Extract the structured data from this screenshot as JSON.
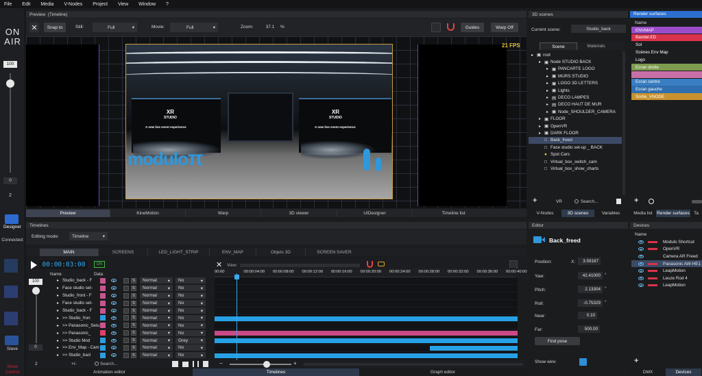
{
  "menu": [
    "File",
    "Edit",
    "Media",
    "V-Nodes",
    "Project",
    "View",
    "Window",
    "?"
  ],
  "left": {
    "on_air_line1": "ON",
    "on_air_line2": "AIR",
    "value_top": "100",
    "value_mid": "0",
    "value_bottom": "2",
    "designer_label": "Designer",
    "connected_label": "Connected:",
    "slave_label": "Slave",
    "show_control_line1": "Show",
    "show_control_line2": "Control"
  },
  "preview": {
    "title_prefix": "Preview",
    "title_suffix": "(Timeline)",
    "snap_label": "Snap to",
    "still_label": "Still:",
    "still_value": "Full",
    "movie_label": "Movie:",
    "movie_value": "Full",
    "zoom_label": "Zoom:",
    "zoom_value": "37.1",
    "zoom_unit": "%",
    "guides_label": "Guides",
    "warp_label": "Warp Off",
    "fps": "21 FPS",
    "logo_line1": "XR",
    "logo_line2": "STUDIO",
    "tagline": "A new live event experience",
    "brand_text": "modulo",
    "brand_symbol": "π",
    "tabs": [
      "Preview",
      "KineMotion",
      "Warp",
      "3D viewer",
      "UIDesigner",
      "Timeline list"
    ]
  },
  "timelines": {
    "title": "Timelines",
    "editing_mode_label": "Editing mode:",
    "editing_mode_value": "Timeline",
    "tabs": [
      "MAIN",
      "SCREENS",
      "LED_LIGHT_STRIP",
      "ENV_MAP",
      "Objets 3D",
      "SCREEN SAVER"
    ],
    "timecode": "00:00:03:00",
    "on_badge": "ON",
    "view_label": "View:",
    "col_name": "Name",
    "col_data": "Data",
    "ruler": [
      "00:00",
      "00:00:04:00",
      "00:00:08:00",
      "00:00:12:00",
      "00:00:16:00",
      "00:00:20:00",
      "00:00:24:00",
      "00:00:28:00",
      "00:00:32:00",
      "00:00:36:00",
      "00:00:40:00"
    ],
    "rows": [
      {
        "name": "Studio_back - F",
        "color": "#c8558f",
        "mode": "Normal",
        "opt": "No",
        "bar": null
      },
      {
        "name": "Face studio set-",
        "color": "#c8558f",
        "mode": "Normal",
        "opt": "No",
        "bar": null
      },
      {
        "name": "Studio_front - F",
        "color": "#c8558f",
        "mode": "Normal",
        "opt": "No",
        "bar": null
      },
      {
        "name": "Face studio set-",
        "color": "#c8558f",
        "mode": "Normal",
        "opt": "No",
        "bar": null
      },
      {
        "name": "Studio_back - F",
        "color": "#c8558f",
        "mode": "Normal",
        "opt": "No",
        "bar": null
      },
      {
        "name": ">> Studio_fron",
        "color": "#2d9de0",
        "mode": "Normal",
        "opt": "No",
        "bar": {
          "start": 0,
          "end": 1,
          "color": "#27a1e6"
        }
      },
      {
        "name": ">> Panasonic_Setu",
        "color": "#c8558f",
        "mode": "Normal",
        "opt": "No",
        "bar": null
      },
      {
        "name": ">> Panasonic_",
        "color": "#e0406a",
        "mode": "Normal",
        "opt": "No",
        "bar": {
          "start": 0,
          "end": 1,
          "color": "#c94a86"
        }
      },
      {
        "name": ">> Studio Mod",
        "color": "#2d9de0",
        "mode": "Normal",
        "opt": "Grey",
        "bar": {
          "start": 0,
          "end": 1,
          "color": "#27a1e6"
        }
      },
      {
        "name": ">> Env_Map - Cam",
        "color": "#2d9de0",
        "mode": "Normal",
        "opt": "No",
        "bar": {
          "start": 0.71,
          "end": 1,
          "color": "#27a1e6"
        }
      },
      {
        "name": ">> Studio_bacl",
        "color": "#2d9de0",
        "mode": "Normal",
        "opt": "No",
        "bar": {
          "start": 0,
          "end": 1,
          "color": "#27a1e6"
        }
      }
    ],
    "foot_left": "2",
    "foot_plusminus": "+/-",
    "search_placeholder": "Search...",
    "bottom_tabs": [
      "Animation editor",
      "Timelines",
      "Graph editor"
    ]
  },
  "scenes": {
    "title": "3D scenes",
    "current_label": "Current scene:",
    "current_value": "Studio_back",
    "tab_scene": "Scene",
    "tab_materials": "Materials",
    "tree": [
      {
        "label": "root",
        "indent": 0,
        "icon": "node"
      },
      {
        "label": "Node STUDIO BACK",
        "indent": 1,
        "icon": "node"
      },
      {
        "label": "PANCARTE LOGO",
        "indent": 2,
        "icon": "node"
      },
      {
        "label": "MURS STUDIO",
        "indent": 2,
        "icon": "node"
      },
      {
        "label": "LOGO 3D LETTERS",
        "indent": 2,
        "icon": "node"
      },
      {
        "label": "Lights",
        "indent": 2,
        "icon": "node"
      },
      {
        "label": "DECO LAMPES",
        "indent": 2,
        "icon": "doc"
      },
      {
        "label": "DECO HAUT DE MUR",
        "indent": 2,
        "icon": "doc"
      },
      {
        "label": "Node_SHOULDER_CAMERA",
        "indent": 2,
        "icon": "node"
      },
      {
        "label": "FLOOR",
        "indent": 1,
        "icon": "node"
      },
      {
        "label": "OpenVR",
        "indent": 1,
        "icon": "node"
      },
      {
        "label": "DARK FLOOR",
        "indent": 1,
        "icon": "node"
      },
      {
        "label": "Back_freed",
        "indent": 1,
        "icon": "box",
        "selected": true
      },
      {
        "label": "Face studio set-up _ BACK",
        "indent": 1,
        "icon": "box"
      },
      {
        "label": "Spot Cars",
        "indent": 1,
        "icon": "bulb"
      },
      {
        "label": "Virtual_box_switch_cam",
        "indent": 1,
        "icon": "box"
      },
      {
        "label": "Virtual_box_show_charts",
        "indent": 1,
        "icon": "box"
      }
    ],
    "vr_label": "VR",
    "search_placeholder": "Search...",
    "bottom_tabs": [
      "V-Nodes",
      "3D scenes",
      "Variables"
    ]
  },
  "editor": {
    "title": "Editor",
    "object_name": "Back_freed",
    "position_label": "Position:",
    "x_label": "X:",
    "x_value": "3.59187",
    "yaw_label": "Yaw:",
    "yaw_value": "42.41000",
    "pitch_label": "Pitch:",
    "pitch_value": "2.13304",
    "roll_label": "Roll:",
    "roll_value": "-0.75329",
    "degree": "°",
    "near_label": "Near:",
    "near_value": "0.10",
    "far_label": "Far:",
    "far_value": "500.00",
    "find_pose_label": "Find pose",
    "show_wire_label": "Show wire:"
  },
  "render_surfaces": {
    "title": "Render surfaces",
    "col_name": "Name",
    "items": [
      {
        "label": "ENVMAP",
        "color": "#9b4dc9"
      },
      {
        "label": "Bandel.ED",
        "color": "#d8334a"
      },
      {
        "label": "Sol",
        "color": ""
      },
      {
        "label": "Scènes Env Map",
        "color": ""
      },
      {
        "label": "Logo",
        "color": ""
      },
      {
        "label": "Ecran droite",
        "color": "#7d9a4e"
      },
      {
        "label": "",
        "color": "#c96fa7"
      },
      {
        "label": "Ecran centre",
        "color": "#3a7ec2"
      },
      {
        "label": "Ecran gauche",
        "color": "#2f6fb0"
      },
      {
        "label": "Sortie_VNODE",
        "color": "#c9922e"
      }
    ],
    "tabs": [
      "Media list",
      "Render surfaces",
      "Ta"
    ]
  },
  "devices": {
    "title": "Devices",
    "col_name": "Name",
    "items": [
      {
        "label": "Modulo Shortcut",
        "color": "#d8334a"
      },
      {
        "label": "OpenVR",
        "color": "#d8334a"
      },
      {
        "label": "Camera AR Freed",
        "color": ""
      },
      {
        "label": "Panasonic AW-HE1",
        "color": "#d8334a",
        "selected": true
      },
      {
        "label": "LeapMotion",
        "color": "#d8334a"
      },
      {
        "label": "Leuze Rod 4",
        "color": "#d8334a"
      },
      {
        "label": "LeapMotion",
        "color": "#d8334a"
      }
    ],
    "bottom_tabs": [
      "DMX",
      "Devices"
    ]
  }
}
